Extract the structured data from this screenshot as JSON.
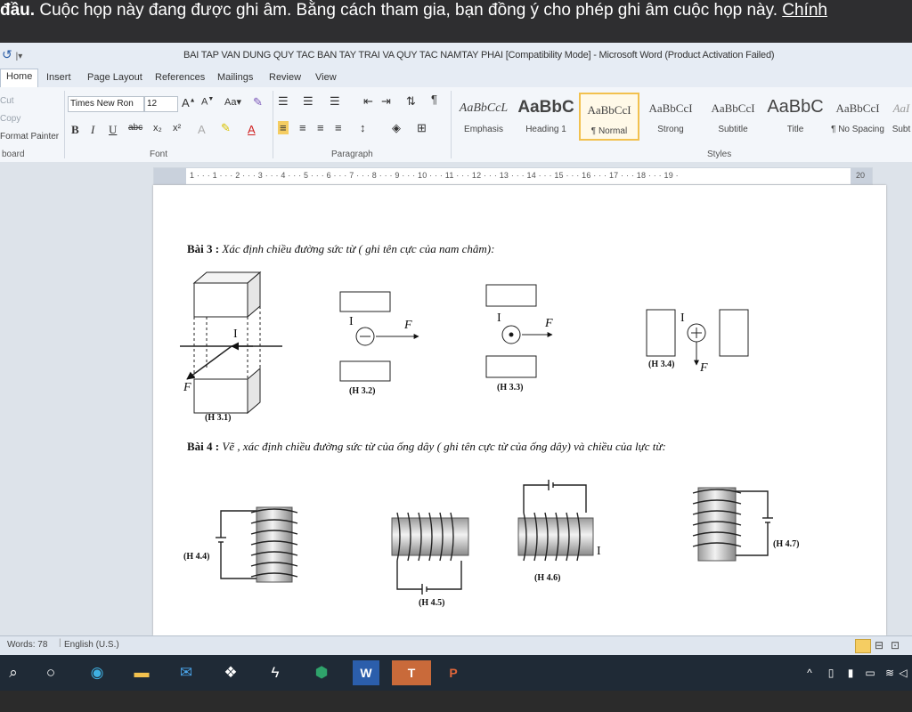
{
  "banner": {
    "bold": "đầu.",
    "text": " Cuộc họp này đang được ghi âm. Bằng cách tham gia, bạn đồng ý cho phép ghi âm cuộc họp này. ",
    "link": "Chính"
  },
  "window": {
    "title": "BAI TAP VAN DUNG QUY TAC BAN TAY TRAI VA QUY TAC NAMTAY PHAI [Compatibility Mode] - Microsoft Word (Product Activation Failed)"
  },
  "tabs": [
    "Home",
    "Insert",
    "Page Layout",
    "References",
    "Mailings",
    "Review",
    "View"
  ],
  "ribbon": {
    "clipboard": {
      "cut": "Cut",
      "copy": "Copy",
      "format_painter": "Format Painter",
      "label": "board"
    },
    "font": {
      "name": "Times New Ron",
      "size": "12",
      "label": "Font"
    },
    "paragraph_label": "Paragraph",
    "styles_label": "Styles",
    "styles": [
      {
        "sample": "AaBbCcL",
        "name": "Emphasis"
      },
      {
        "sample": "AaBbC",
        "name": "Heading 1"
      },
      {
        "sample": "AaBbCcI",
        "name": "¶ Normal"
      },
      {
        "sample": "AaBbCcI",
        "name": "Strong"
      },
      {
        "sample": "AaBbCcI",
        "name": "Subtitle"
      },
      {
        "sample": "AaBbC",
        "name": "Title"
      },
      {
        "sample": "AaBbCcI",
        "name": "¶ No Spacing"
      },
      {
        "sample": "AaI",
        "name": "Subt"
      }
    ]
  },
  "ruler": {
    "ticks": "1 · · · 1 · · · 2 · · · 3 · · · 4 · · · 5 · · · 6 · · · 7 · · · 8 · · · 9 · · · 10 · · · 11 · · · 12 · · · 13 · · · 14 · · · 15 · · · 16 · · · 17 · · · 18 · · · 19 ·",
    "end": "20"
  },
  "doc": {
    "bai3_label": "Bài 3 :",
    "bai3_text": " Xác định chiều đường sức từ ( ghi tên cực của nam châm):",
    "bai4_label": "Bài 4 :",
    "bai4_text": " Vẽ , xác định chiều đường sức từ của ống dây ( ghi tên cực từ của ống dây) và chiều của lực từ:",
    "figs": {
      "h31": "(H 3.1)",
      "h32": "(H 3.2)",
      "h33": "(H 3.3)",
      "h34": "(H 3.4)",
      "h44": "(H 4.4)",
      "h45": "(H 4.5)",
      "h46": "(H 4.6)",
      "h47": "(H 4.7)"
    },
    "sym_I": "I",
    "sym_F": "F"
  },
  "status": {
    "words": "Words: 78",
    "lang": "English (U.S.)"
  }
}
